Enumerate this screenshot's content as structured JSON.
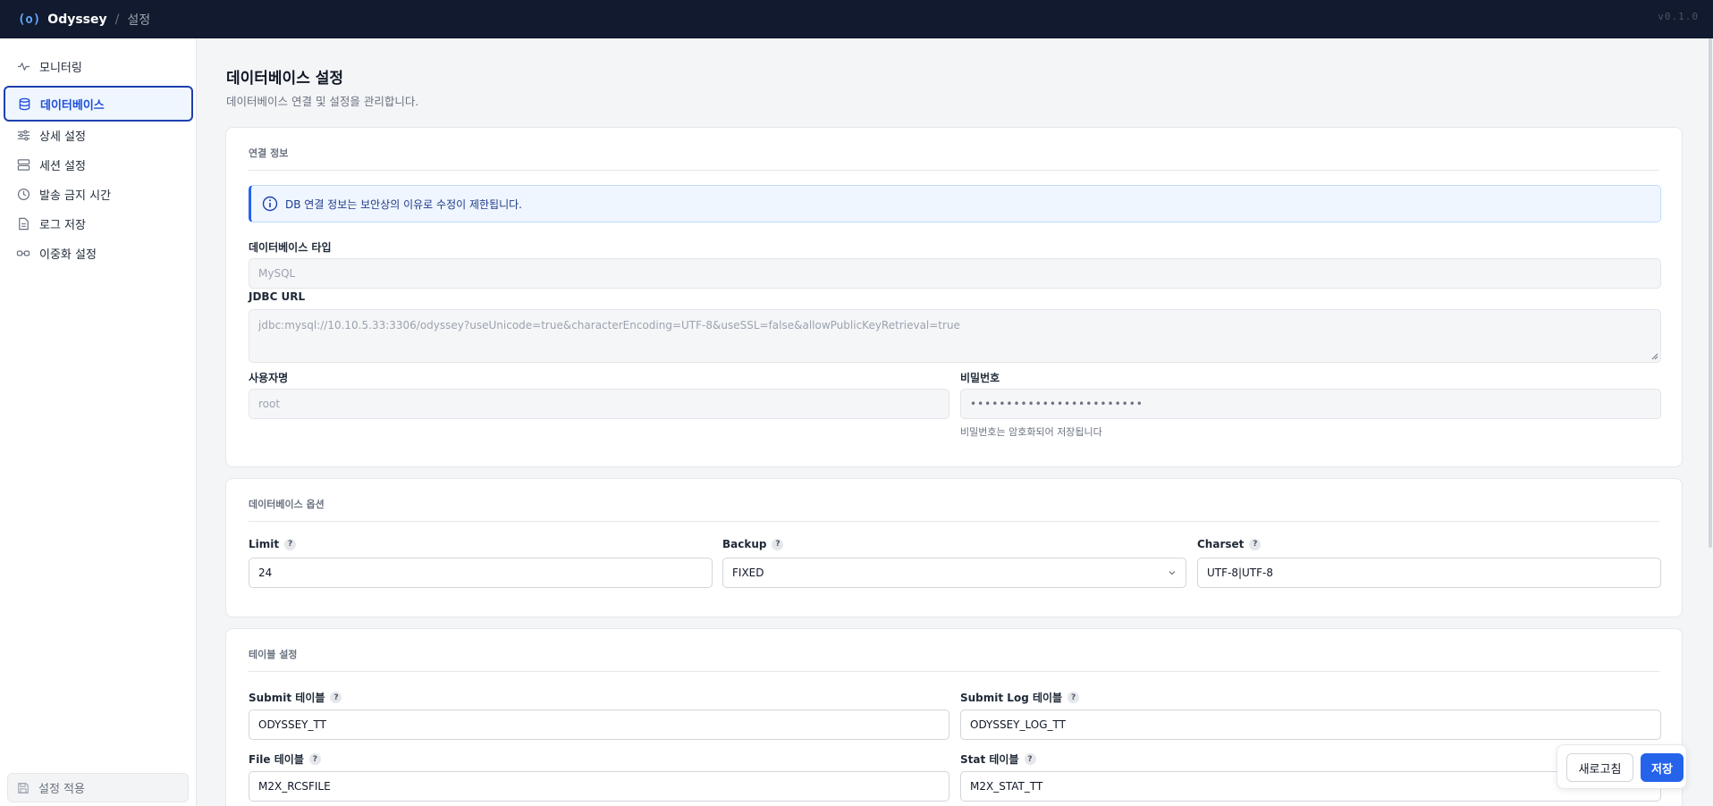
{
  "header": {
    "brand_icon": "(o)",
    "brand_name": "Odyssey",
    "separator": "/",
    "page": "설정",
    "version": "v0.1.0"
  },
  "sidebar": {
    "items": [
      {
        "label": "모니터링",
        "icon": "activity-icon"
      },
      {
        "label": "데이터베이스",
        "icon": "database-icon",
        "active": true
      },
      {
        "label": "상세 설정",
        "icon": "sliders-icon"
      },
      {
        "label": "세션 설정",
        "icon": "server-icon"
      },
      {
        "label": "발송 금지 시간",
        "icon": "clock-icon"
      },
      {
        "label": "로그 저장",
        "icon": "file-icon"
      },
      {
        "label": "이중화 설정",
        "icon": "link-icon"
      }
    ],
    "apply_label": "설정 적용"
  },
  "page": {
    "title": "데이터베이스 설정",
    "subtitle": "데이터베이스 연결 및 설정을 관리합니다."
  },
  "connection": {
    "heading": "연결 정보",
    "notice": "DB 연결 정보는 보안상의 이유로 수정이 제한됩니다.",
    "db_type_label": "데이터베이스 타입",
    "db_type_value": "MySQL",
    "jdbc_label": "JDBC URL",
    "jdbc_value": "jdbc:mysql://10.10.5.33:3306/odyssey?useUnicode=true&characterEncoding=UTF-8&useSSL=false&allowPublicKeyRetrieval=true",
    "username_label": "사용자명",
    "username_value": "root",
    "password_label": "비밀번호",
    "password_value": "••••••••••••••••••••••••",
    "password_hint": "비밀번호는 암호화되어 저장됩니다"
  },
  "options": {
    "heading": "데이터베이스 옵션",
    "limit_label": "Limit",
    "limit_value": "24",
    "backup_label": "Backup",
    "backup_value": "FIXED",
    "charset_label": "Charset",
    "charset_value": "UTF-8|UTF-8"
  },
  "tables": {
    "heading": "테이블 설정",
    "submit_label": "Submit 테이블",
    "submit_value": "ODYSSEY_TT",
    "submit_log_label": "Submit Log 테이블",
    "submit_log_value": "ODYSSEY_LOG_TT",
    "file_label": "File 테이블",
    "file_value": "M2X_RCSFILE",
    "stat_label": "Stat 테이블",
    "stat_value": "M2X_STAT_TT"
  },
  "actions": {
    "refresh_label": "새로고침",
    "save_label": "저장"
  },
  "help_glyph": "?",
  "colors": {
    "topbar": "#111a2e",
    "accent": "#2563eb",
    "active_border": "#1e40af"
  }
}
